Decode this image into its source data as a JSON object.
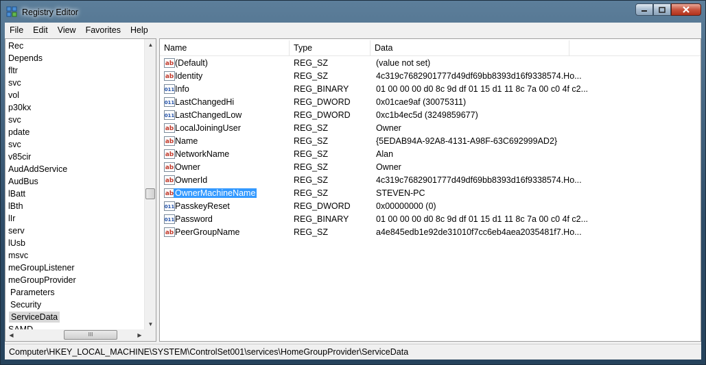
{
  "window": {
    "title": "Registry Editor"
  },
  "menu": [
    "File",
    "Edit",
    "View",
    "Favorites",
    "Help"
  ],
  "tree": {
    "items": [
      {
        "label": "Rec",
        "selected": false
      },
      {
        "label": "Depends",
        "selected": false
      },
      {
        "label": "fltr",
        "selected": false
      },
      {
        "label": "svc",
        "selected": false
      },
      {
        "label": "vol",
        "selected": false
      },
      {
        "label": "p30kx",
        "selected": false
      },
      {
        "label": "svc",
        "selected": false
      },
      {
        "label": "pdate",
        "selected": false
      },
      {
        "label": "svc",
        "selected": false
      },
      {
        "label": "v85cir",
        "selected": false
      },
      {
        "label": "AudAddService",
        "selected": false
      },
      {
        "label": "AudBus",
        "selected": false
      },
      {
        "label": "lBatt",
        "selected": false
      },
      {
        "label": "lBth",
        "selected": false
      },
      {
        "label": "lIr",
        "selected": false
      },
      {
        "label": "serv",
        "selected": false
      },
      {
        "label": "lUsb",
        "selected": false
      },
      {
        "label": "msvc",
        "selected": false
      },
      {
        "label": "meGroupListener",
        "selected": false
      },
      {
        "label": "meGroupProvider",
        "selected": false
      },
      {
        "label": "Parameters",
        "selected": false
      },
      {
        "label": "Security",
        "selected": false
      },
      {
        "label": "ServiceData",
        "selected": true
      },
      {
        "label": "SAMD",
        "selected": false
      }
    ],
    "hscroll_grip": "III"
  },
  "columns": [
    "Name",
    "Type",
    "Data"
  ],
  "values": [
    {
      "name": "(Default)",
      "type": "REG_SZ",
      "data": "(value not set)",
      "icon": "string-value-icon"
    },
    {
      "name": "Identity",
      "type": "REG_SZ",
      "data": "4c319c7682901777d49df69bb8393d16f9338574.Ho...",
      "icon": "string-value-icon"
    },
    {
      "name": "Info",
      "type": "REG_BINARY",
      "data": "01 00 00 00 d0 8c 9d df 01 15 d1 11 8c 7a 00 c0 4f c2...",
      "icon": "binary-value-icon"
    },
    {
      "name": "LastChangedHi",
      "type": "REG_DWORD",
      "data": "0x01cae9af (30075311)",
      "icon": "binary-value-icon"
    },
    {
      "name": "LastChangedLow",
      "type": "REG_DWORD",
      "data": "0xc1b4ec5d (3249859677)",
      "icon": "binary-value-icon"
    },
    {
      "name": "LocalJoiningUser",
      "type": "REG_SZ",
      "data": "Owner",
      "icon": "string-value-icon"
    },
    {
      "name": "Name",
      "type": "REG_SZ",
      "data": "{5EDAB94A-92A8-4131-A98F-63C692999AD2}",
      "icon": "string-value-icon"
    },
    {
      "name": "NetworkName",
      "type": "REG_SZ",
      "data": "Alan",
      "icon": "string-value-icon"
    },
    {
      "name": "Owner",
      "type": "REG_SZ",
      "data": "Owner",
      "icon": "string-value-icon"
    },
    {
      "name": "OwnerId",
      "type": "REG_SZ",
      "data": "4c319c7682901777d49df69bb8393d16f9338574.Ho...",
      "icon": "string-value-icon"
    },
    {
      "name": "OwnerMachineName",
      "type": "REG_SZ",
      "data": "STEVEN-PC",
      "icon": "string-value-icon",
      "selected": true
    },
    {
      "name": "PasskeyReset",
      "type": "REG_DWORD",
      "data": "0x00000000 (0)",
      "icon": "binary-value-icon"
    },
    {
      "name": "Password",
      "type": "REG_BINARY",
      "data": "01 00 00 00 d0 8c 9d df 01 15 d1 11 8c 7a 00 c0 4f c2...",
      "icon": "binary-value-icon"
    },
    {
      "name": "PeerGroupName",
      "type": "REG_SZ",
      "data": "a4e845edb1e92de31010f7cc6eb4aea2035481f7.Ho...",
      "icon": "string-value-icon"
    }
  ],
  "status": {
    "path": "Computer\\HKEY_LOCAL_MACHINE\\SYSTEM\\ControlSet001\\services\\HomeGroupProvider\\ServiceData"
  },
  "colors": {
    "selection": "#3399ff",
    "string_icon": "#c0392b",
    "binary_icon": "#1f4fa8"
  }
}
